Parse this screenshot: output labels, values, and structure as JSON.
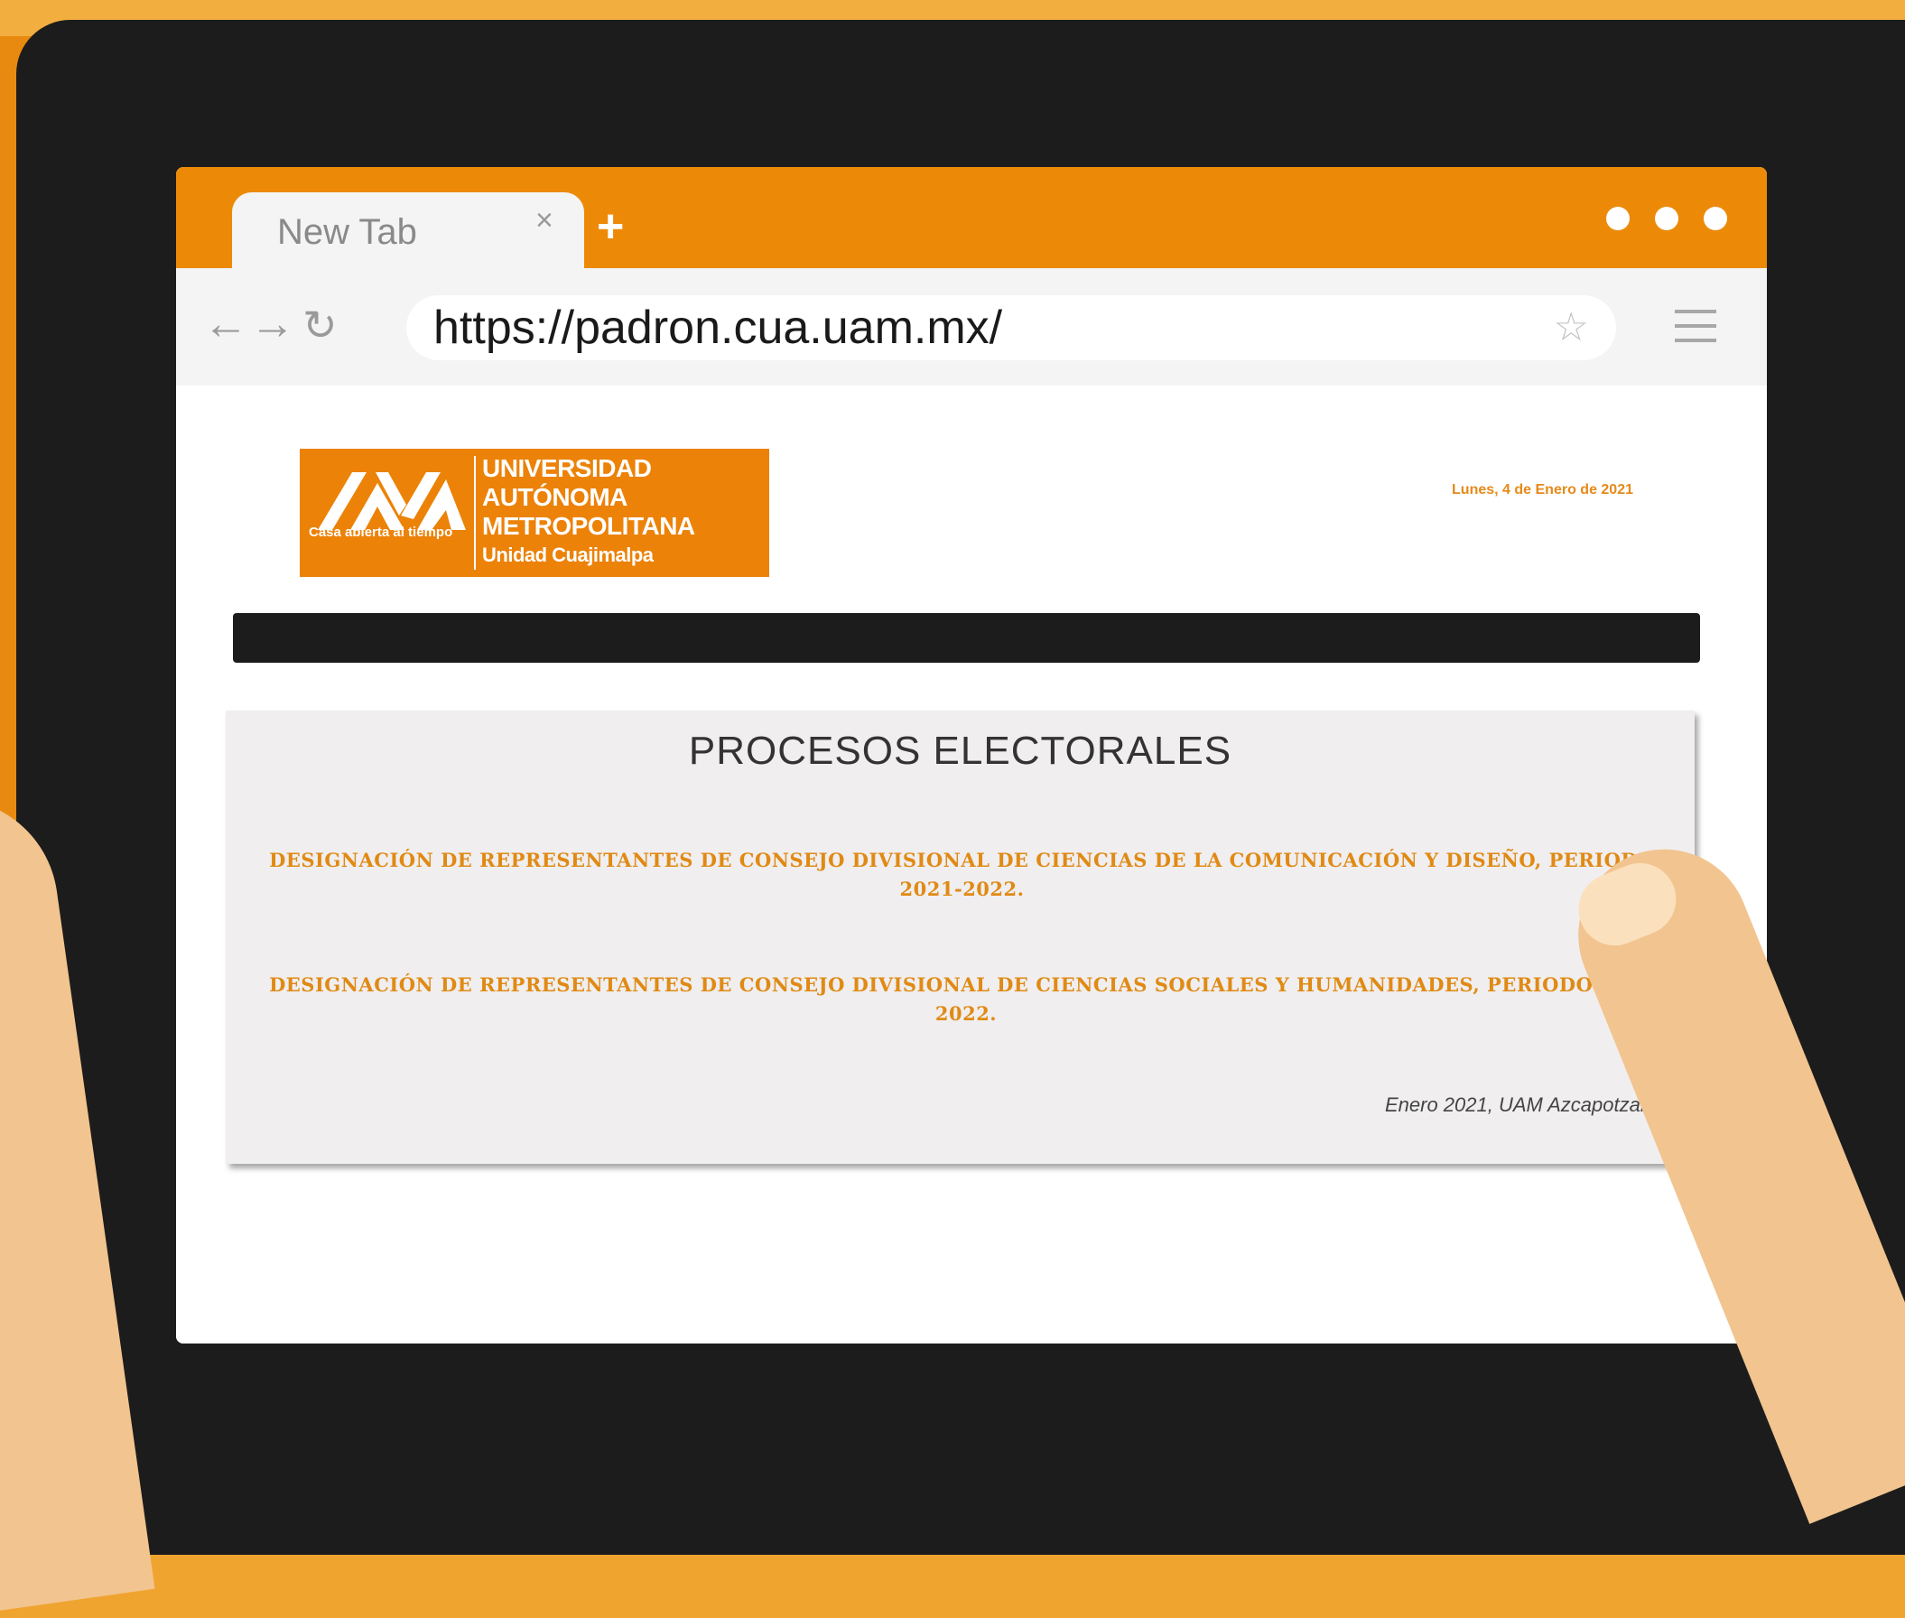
{
  "browser": {
    "tab_title": "New Tab",
    "tab_close": "×",
    "new_tab": "+",
    "url": "https://padron.cua.uam.mx/",
    "back": "←",
    "forward": "→",
    "reload": "↻",
    "bookmark": "☆"
  },
  "logo": {
    "tagline": "Casa abierta al tiempo",
    "line1": "UNIVERSIDAD",
    "line2": "AUTÓNOMA",
    "line3": "METROPOLITANA",
    "line4": "Unidad Cuajimalpa"
  },
  "header": {
    "date": "Lunes, 4 de Enero de 2021"
  },
  "panel": {
    "title": "PROCESOS ELECTORALES",
    "links": [
      "DESIGNACIÓN DE REPRESENTANTES DE CONSEJO DIVISIONAL DE CIENCIAS DE LA COMUNICACIÓN Y DISEÑO, PERIODO 2021-2022.",
      "DESIGNACIÓN DE REPRESENTANTES DE CONSEJO DIVISIONAL DE CIENCIAS SOCIALES Y HUMANIDADES, PERIODO 2021-2022."
    ],
    "footer": "Enero 2021, UAM Azcapotzalco"
  },
  "colors": {
    "brand_orange": "#ec8a08",
    "link_orange": "#e08a14",
    "tablet_frame": "#1c1c1c",
    "skin": "#f2c48f"
  }
}
